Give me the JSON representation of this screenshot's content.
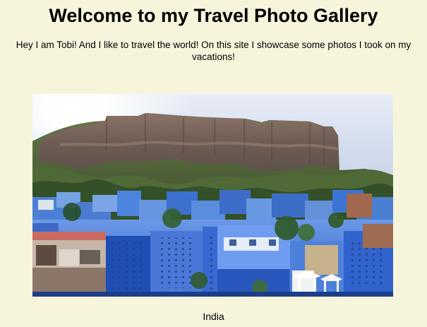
{
  "gallery": {
    "title": "Welcome to my Travel Photo Gallery",
    "intro": "Hey I am Tobi! And I like to travel the world! On this site I showcase some photos I took on my vacations!",
    "photo": {
      "caption": "India",
      "icon": "photo-image"
    }
  }
}
